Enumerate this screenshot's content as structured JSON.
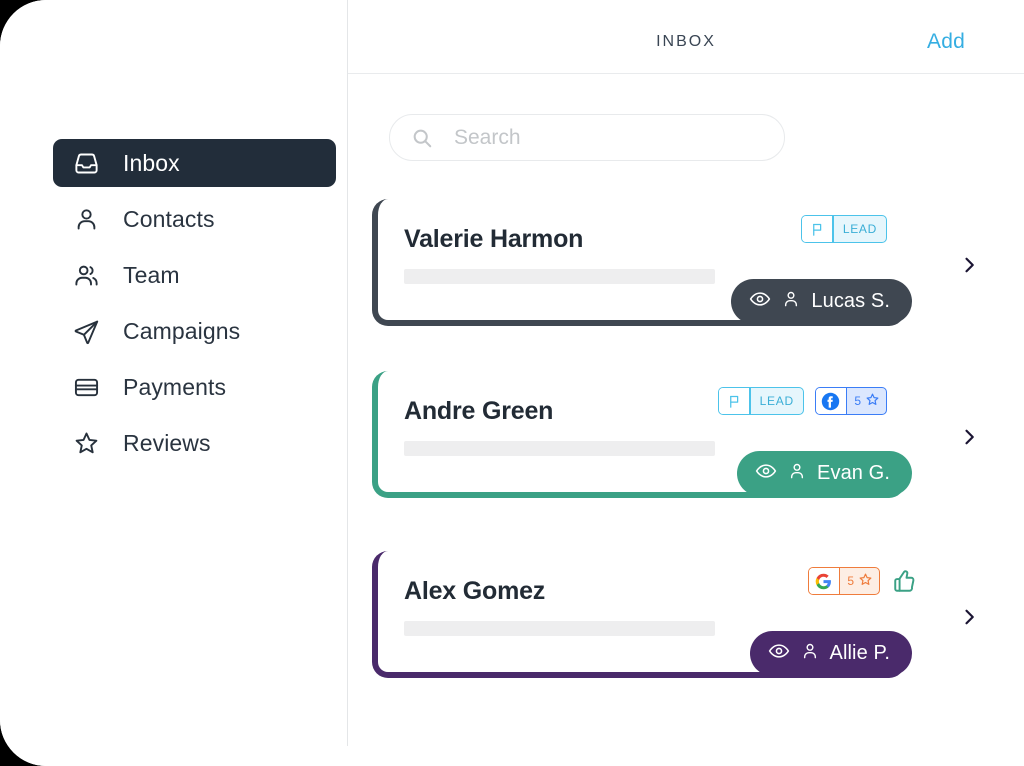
{
  "app": {
    "background_color": "#000000",
    "panel_color": "#ffffff"
  },
  "sidebar": {
    "items": [
      {
        "label": "Inbox",
        "icon": "inbox-icon",
        "active": true
      },
      {
        "label": "Contacts",
        "icon": "person-icon",
        "active": false
      },
      {
        "label": "Team",
        "icon": "people-icon",
        "active": false
      },
      {
        "label": "Campaigns",
        "icon": "send-icon",
        "active": false
      },
      {
        "label": "Payments",
        "icon": "credit-card-icon",
        "active": false
      },
      {
        "label": "Reviews",
        "icon": "star-icon",
        "active": false
      }
    ],
    "active_bg": "#222d3a",
    "active_fg": "#ffffff"
  },
  "header": {
    "title": "INBOX",
    "add_label": "Add",
    "add_color": "#35aee2"
  },
  "search": {
    "placeholder": "Search",
    "value": "",
    "icon": "search-icon"
  },
  "conversations": [
    {
      "name": "Valerie Harmon",
      "accent_color": "#3f4751",
      "assignee": {
        "name": "Lucas S.",
        "bg": "#3f4751",
        "icons": [
          "eye-icon",
          "person-icon"
        ]
      },
      "badges": [
        {
          "type": "lead",
          "icon": "flag-icon",
          "label": "LEAD"
        }
      ],
      "chevron": "chevron-right-icon"
    },
    {
      "name": "Andre Green",
      "accent_color": "#3ba185",
      "assignee": {
        "name": "Evan G.",
        "bg": "#3ba185",
        "icons": [
          "eye-icon",
          "person-icon"
        ]
      },
      "badges": [
        {
          "type": "lead",
          "icon": "flag-icon",
          "label": "LEAD"
        },
        {
          "type": "facebook",
          "icon": "facebook-icon",
          "rating": "5",
          "rating_icon": "star-outline-icon"
        }
      ],
      "chevron": "chevron-right-icon"
    },
    {
      "name": "Alex Gomez",
      "accent_color": "#4a2a6b",
      "assignee": {
        "name": "Allie P.",
        "bg": "#4a2a6b",
        "icons": [
          "eye-icon",
          "person-icon"
        ]
      },
      "badges": [
        {
          "type": "google",
          "icon": "google-icon",
          "rating": "5",
          "rating_icon": "star-outline-icon"
        }
      ],
      "extra_icon": "thumbs-up-icon",
      "chevron": "chevron-right-icon"
    }
  ]
}
